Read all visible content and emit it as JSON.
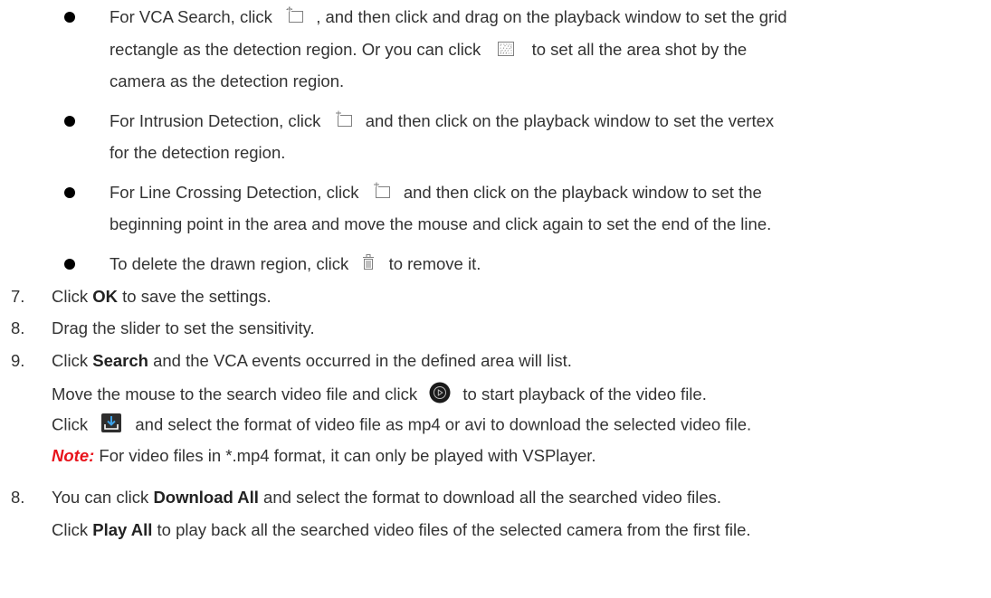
{
  "bullets": [
    {
      "lines": [
        {
          "before": "For VCA Search, click",
          "icon": "add-region-icon",
          "after": ", and then click and drag on the playback window to set the grid"
        },
        {
          "text": "rectangle as the detection region. Or you can click",
          "icon": "full-screen-grid-icon",
          "after": "to set all the area shot by the"
        },
        {
          "text": "camera as the detection region."
        }
      ]
    },
    {
      "lines": [
        {
          "before": "For Intrusion Detection, click",
          "icon": "add-region-icon",
          "after": "and then click on the playback window to set the vertex"
        },
        {
          "text": "for the detection region."
        }
      ]
    },
    {
      "lines": [
        {
          "before": "For Line Crossing Detection, click",
          "icon": "add-region-icon",
          "after": "and then click on the playback window to set the"
        },
        {
          "text": "beginning point in the area and move the mouse and click again to set the end of the line."
        }
      ]
    },
    {
      "lines": [
        {
          "before": "To delete the drawn region, click",
          "icon": "delete-icon",
          "after": "to remove it."
        }
      ]
    }
  ],
  "steps": [
    {
      "num": "7.",
      "pre": "Click ",
      "bold": "OK",
      "post": " to save the settings."
    },
    {
      "num": "8.",
      "text": "Drag the slider to set the sensitivity."
    },
    {
      "num": "9.",
      "pre": "Click ",
      "bold": "Search",
      "post": " and the VCA events occurred in the defined area will list."
    }
  ],
  "step9_sub": {
    "line1_before": "Move the mouse to the search video file and click",
    "line1_after": "to start playback of the video file.",
    "line2_before": "Click",
    "line2_after": "and select the format of video file as mp4 or avi to download the selected video file.",
    "note_label": "Note:",
    "note_text": " For video files in *.mp4 format, it can only be played with VSPlayer."
  },
  "step10": {
    "num": "8.",
    "pre": "You can click ",
    "bold": "Download All",
    "post": " and select the format to download all the searched video files.",
    "line2_pre": "Click ",
    "line2_bold": "Play All",
    "line2_post": " to play back all the searched video files of the selected camera from the first file."
  },
  "colors": {
    "text": "#333333",
    "note": "#e8141c",
    "bullet": "#000000",
    "icon_gray": "#808080",
    "download_icon_bg": "#2e2e2e",
    "play_icon_bg": "#1a1a1a"
  }
}
